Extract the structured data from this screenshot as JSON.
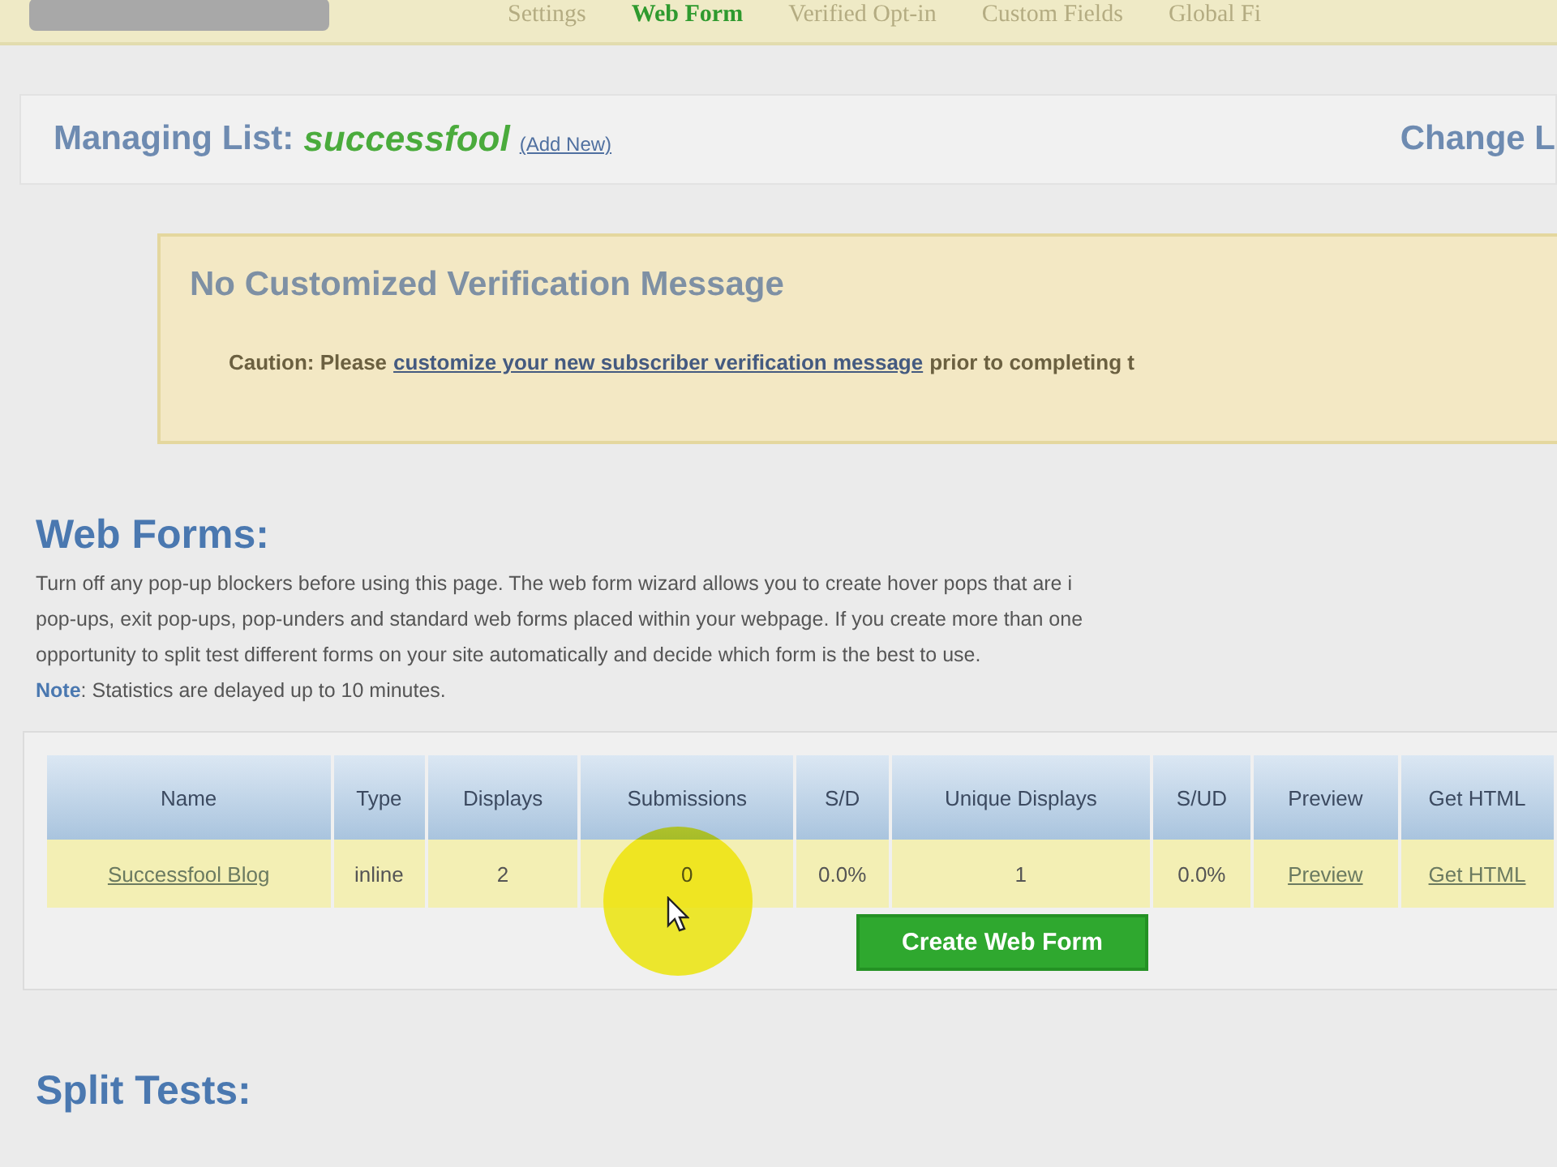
{
  "tabs": [
    {
      "label": "Settings",
      "selected": false
    },
    {
      "label": "Web Form",
      "selected": true
    },
    {
      "label": "Verified Opt-in",
      "selected": false
    },
    {
      "label": "Custom Fields",
      "selected": false
    },
    {
      "label": "Global Fi",
      "selected": false
    }
  ],
  "list_header": {
    "label": "Managing List:",
    "list_name": "successfool",
    "add_link": "(Add New)",
    "change_link": "Change L"
  },
  "notice": {
    "title": "No Customized Verification Message",
    "text_before": "Caution: Please",
    "link": "customize your new subscriber verification message",
    "text_after": "prior to completing t"
  },
  "web_forms": {
    "heading": "Web Forms:",
    "lines": [
      "Turn off any pop-up blockers before using this page. The web form wizard allows you to create hover pops that are i",
      "pop-ups, exit pop-ups, pop-unders and standard web forms placed within your webpage. If you create more than one",
      "opportunity to split test different forms on your site automatically and decide which form is the best to use."
    ],
    "note_label": "Note",
    "note_text": ": Statistics are delayed up to 10 minutes.",
    "table": {
      "columns": [
        "Name",
        "Type",
        "Displays",
        "Submissions",
        "S/D",
        "Unique Displays",
        "S/UD",
        "Preview",
        "Get HTML"
      ],
      "rows": [
        {
          "cells": [
            {
              "text": "Successfool Blog",
              "kind": "link"
            },
            {
              "text": "inline",
              "kind": "text"
            },
            {
              "text": "2",
              "kind": "text"
            },
            {
              "text": "0",
              "kind": "text"
            },
            {
              "text": "0.0%",
              "kind": "text"
            },
            {
              "text": "1",
              "kind": "text"
            },
            {
              "text": "0.0%",
              "kind": "text"
            },
            {
              "text": "Preview",
              "kind": "link"
            },
            {
              "text": "Get HTML",
              "kind": "link"
            }
          ]
        }
      ]
    },
    "create_button": "Create Web Form"
  },
  "split_tests": {
    "heading": "Split Tests:"
  }
}
